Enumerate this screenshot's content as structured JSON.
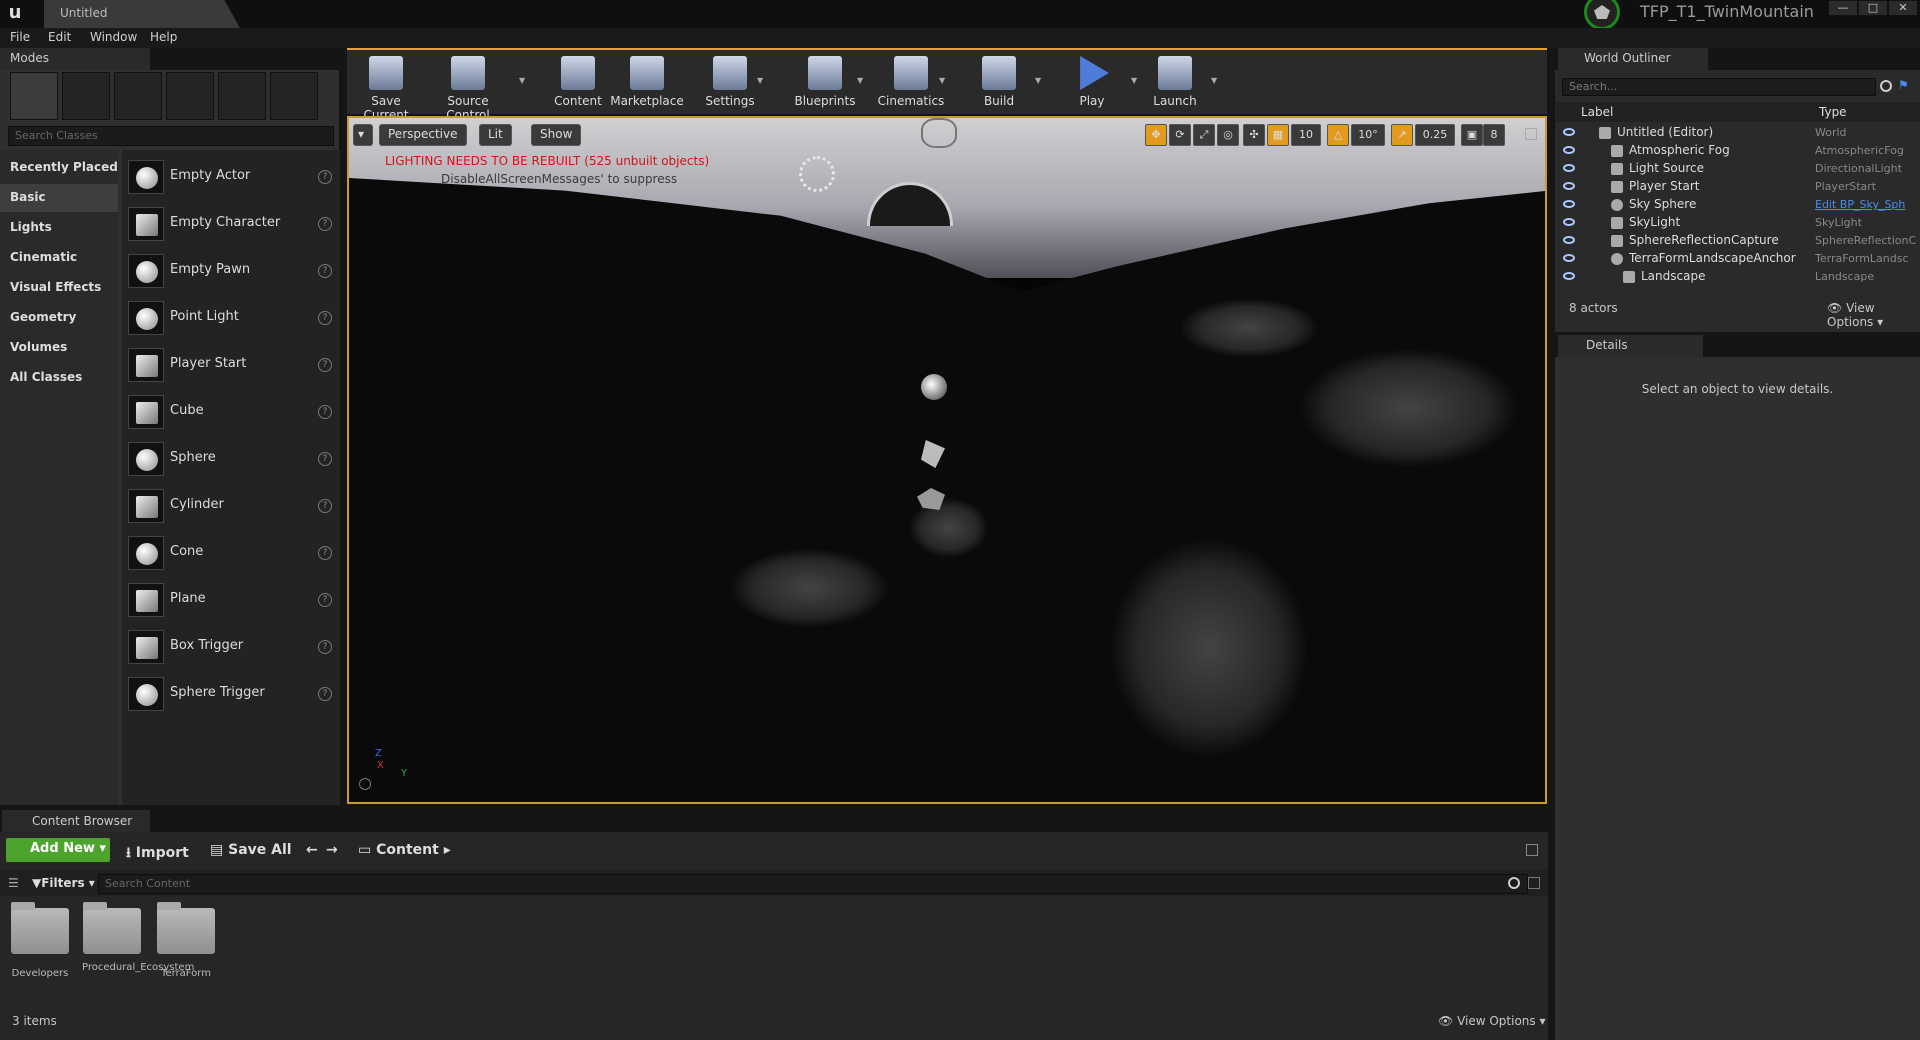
{
  "window": {
    "doc_tab": "Untitled",
    "project_name": "TFP_T1_TwinMountain",
    "min_label": "—",
    "max_label": "□",
    "close_label": "✕"
  },
  "menu": [
    "File",
    "Edit",
    "Window",
    "Help"
  ],
  "modes": {
    "tab_label": "Modes",
    "search_placeholder": "Search Classes",
    "categories": [
      "Recently Placed",
      "Basic",
      "Lights",
      "Cinematic",
      "Visual Effects",
      "Geometry",
      "Volumes",
      "All Classes"
    ],
    "active_category": "Basic",
    "items": [
      "Empty Actor",
      "Empty Character",
      "Empty Pawn",
      "Point Light",
      "Player Start",
      "Cube",
      "Sphere",
      "Cylinder",
      "Cone",
      "Plane",
      "Box Trigger",
      "Sphere Trigger"
    ]
  },
  "toolbar": {
    "buttons": [
      "Save Current",
      "Source Control",
      "Content",
      "Marketplace",
      "Settings",
      "Blueprints",
      "Cinematics",
      "Build",
      "Play",
      "Launch"
    ]
  },
  "viewport": {
    "perspective": "Perspective",
    "lit": "Lit",
    "show": "Show",
    "warning": "LIGHTING NEEDS TO BE REBUILT (525 unbuilt objects)",
    "warning_sub": "DisableAllScreenMessages' to suppress",
    "grid_snap": "10",
    "rot_snap": "10°",
    "scale_snap": "0.25",
    "cam_speed": "8",
    "axis_z": "Z",
    "axis_x": "X",
    "axis_y": "Y"
  },
  "world_outliner": {
    "tab_label": "World Outliner",
    "search_placeholder": "Search...",
    "col_label": "Label",
    "col_type": "Type",
    "rows": [
      {
        "label": "Untitled (Editor)",
        "type": "World"
      },
      {
        "label": "Atmospheric Fog",
        "type": "AtmosphericFog"
      },
      {
        "label": "Light Source",
        "type": "DirectionalLight"
      },
      {
        "label": "Player Start",
        "type": "PlayerStart"
      },
      {
        "label": "Sky Sphere",
        "type": "Edit BP_Sky_Sph"
      },
      {
        "label": "SkyLight",
        "type": "SkyLight"
      },
      {
        "label": "SphereReflectionCapture",
        "type": "SphereReflectionC"
      },
      {
        "label": "TerraFormLandscapeAnchor",
        "type": "TerraFormLandsc"
      },
      {
        "label": "Landscape",
        "type": "Landscape"
      }
    ],
    "actor_count": "8 actors",
    "view_options": "View Options"
  },
  "details": {
    "tab_label": "Details",
    "empty_message": "Select an object to view details."
  },
  "content_browser": {
    "tab_label": "Content Browser",
    "add_new": "Add New",
    "import": "Import",
    "save_all": "Save All",
    "path": "Content",
    "filters": "Filters",
    "search_placeholder": "Search Content",
    "folders": [
      "Developers",
      "Procedural_Ecosystem",
      "TerraForm"
    ],
    "item_count": "3 items",
    "view_options": "View Options"
  },
  "colors": {
    "accent_orange": "#e29a1f",
    "warning_red": "#d21515",
    "add_new_green": "#4ca42c",
    "link_blue": "#4a8cf0"
  }
}
